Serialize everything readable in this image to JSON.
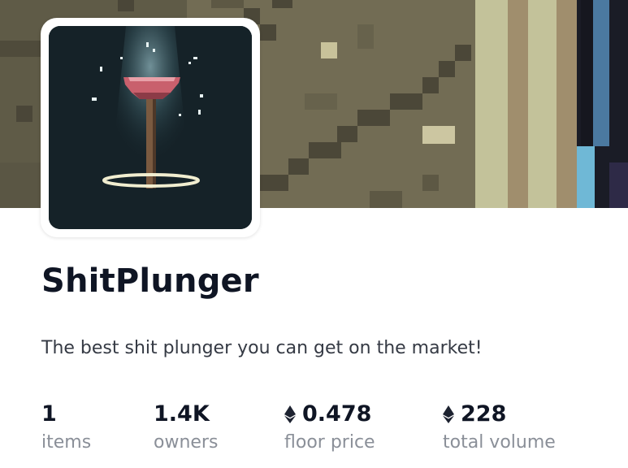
{
  "collection": {
    "name": "ShitPlunger",
    "description": "The best shit plunger you can get on the market!"
  },
  "stats": [
    {
      "value": "1",
      "label": "items",
      "currency_icon": null
    },
    {
      "value": "1.4K",
      "label": "owners",
      "currency_icon": null
    },
    {
      "value": "0.478",
      "label": "floor price",
      "currency_icon": "ethereum-icon"
    },
    {
      "value": "228",
      "label": "total volume",
      "currency_icon": "ethereum-icon"
    }
  ],
  "colors": {
    "banner_base": "#6f6a52",
    "avatar_bg": "#152228",
    "title": "#0f1524",
    "label": "#8a8f98"
  }
}
